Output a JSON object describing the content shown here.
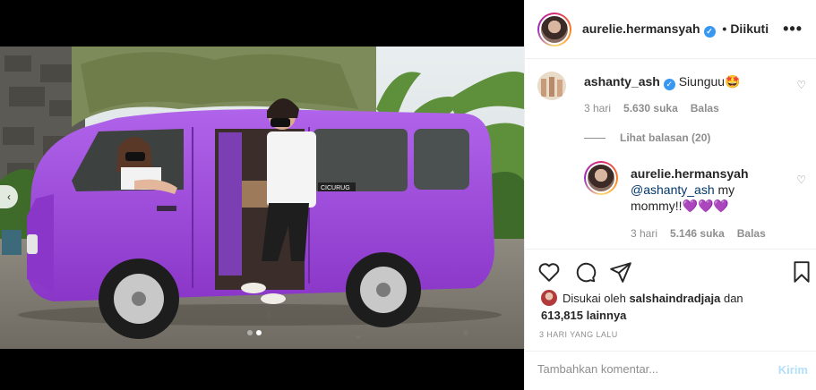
{
  "post": {
    "username": "aurelie.hermansyah",
    "follow_label": "Diikuti",
    "separator": "•",
    "more_label": "•••"
  },
  "comments": [
    {
      "username": "ashanty_ash",
      "text": "Siunguu🤩",
      "time": "3 hari",
      "likes": "5.630 suka",
      "reply_label": "Balas"
    }
  ],
  "view_replies": "Lihat balasan (20)",
  "replies": [
    {
      "username": "aurelie.hermansyah",
      "mention": "@ashanty_ash",
      "text": " my mommy!!💜💜💜",
      "time": "3 hari",
      "likes": "5.146 suka",
      "reply_label": "Balas"
    }
  ],
  "likes": {
    "prefix": "Disukai oleh",
    "user": "salshaindradjaja",
    "conj": "dan",
    "count": "613,815 lainnya"
  },
  "timestamp": "3 HARI YANG LALU",
  "comment_box": {
    "placeholder": "Tambahkan komentar...",
    "post_label": "Kirim"
  },
  "icons": {
    "like": "heart-icon",
    "comment": "comment-icon",
    "share": "share-icon",
    "save": "bookmark-icon"
  },
  "colors": {
    "van": "#9b45d8",
    "verified": "#3897f0",
    "post_button": "#b2dffc"
  }
}
